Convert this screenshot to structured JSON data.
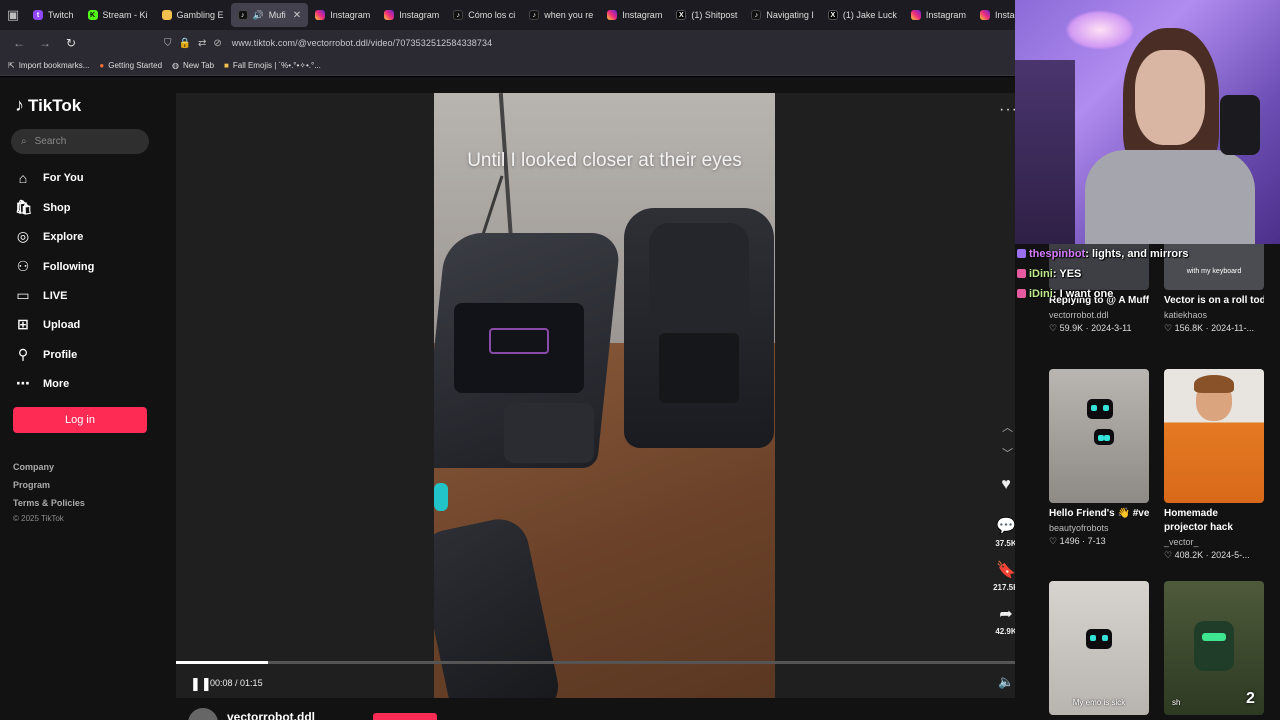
{
  "browser": {
    "tabs": [
      {
        "label": "Twitch",
        "icon": "twitch"
      },
      {
        "label": "Stream - Ki",
        "icon": "kick"
      },
      {
        "label": "Gambling E",
        "icon": "folder"
      },
      {
        "label": "Mufi",
        "icon": "tiktok",
        "active": true
      },
      {
        "label": "Instagram",
        "icon": "insta"
      },
      {
        "label": "Instagram",
        "icon": "insta"
      },
      {
        "label": "Cómo los ci",
        "icon": "tiktok"
      },
      {
        "label": "when you re",
        "icon": "tiktok"
      },
      {
        "label": "Instagram",
        "icon": "insta"
      },
      {
        "label": "(1) Shitpost",
        "icon": "x"
      },
      {
        "label": "Navigating I",
        "icon": "tiktok"
      },
      {
        "label": "(1) Jake Luck",
        "icon": "x"
      },
      {
        "label": "Instagram",
        "icon": "insta"
      },
      {
        "label": "Instagra",
        "icon": "insta"
      }
    ],
    "url": "www.tiktok.com/@vectorrobot.ddl/video/7073532512584338734",
    "bookmarks": [
      "Import bookmarks...",
      "Getting Started",
      "New Tab",
      "Fall Emojis | ´%•.°•✧•.°..."
    ]
  },
  "sidebar": {
    "brand": "TikTok",
    "search_placeholder": "Search",
    "nav": [
      {
        "label": "For You",
        "icon": "home-icon"
      },
      {
        "label": "Shop",
        "icon": "shop-icon"
      },
      {
        "label": "Explore",
        "icon": "compass-icon"
      },
      {
        "label": "Following",
        "icon": "user-icon"
      },
      {
        "label": "LIVE",
        "icon": "live-icon"
      },
      {
        "label": "Upload",
        "icon": "plus-square-icon"
      },
      {
        "label": "Profile",
        "icon": "profile-icon"
      },
      {
        "label": "More",
        "icon": "more-icon"
      }
    ],
    "login_label": "Log in",
    "footer_links": [
      "Company",
      "Program",
      "Terms & Policies"
    ],
    "copyright": "© 2025 TikTok"
  },
  "video": {
    "caption": "Until I looked closer at their eyes",
    "actions": {
      "comments": "37.5K",
      "saves": "217.5K",
      "shares": "42.9K"
    },
    "current_time": "00:08",
    "duration": "01:15",
    "progress_fraction": 0.11,
    "author": "vectorrobot.ddl"
  },
  "stream_chat": [
    {
      "user": "thespinbot",
      "message": "lights, and mirrors"
    },
    {
      "user": "iDini",
      "message": "YES"
    },
    {
      "user": "iDini",
      "message": "I want one"
    }
  ],
  "related": [
    {
      "title": "Replying to @ A Muffi...",
      "author": "vectorrobot.ddl",
      "likes": "59.9K",
      "date": "2024-3-11"
    },
    {
      "title": "Vector is on a roll today. #vector...",
      "author": "katiekhaos",
      "likes": "156.8K",
      "date": "2024-11-...",
      "overlay": "with my keyboard"
    },
    {
      "title": "Hello Friend's 👋 #vectorrobot...",
      "author": "beautyofrobots",
      "likes": "1496",
      "date": "7-13"
    },
    {
      "title": "Homemade projector hack",
      "author": "_vector_",
      "likes": "408.2K",
      "date": "2024-5-..."
    },
    {
      "title": "",
      "author": "",
      "likes": "",
      "date": "",
      "overlay": "My emo is sick"
    },
    {
      "title": "",
      "author": "",
      "likes": "",
      "date": "",
      "overlay": "sh"
    }
  ],
  "live_count": "2"
}
